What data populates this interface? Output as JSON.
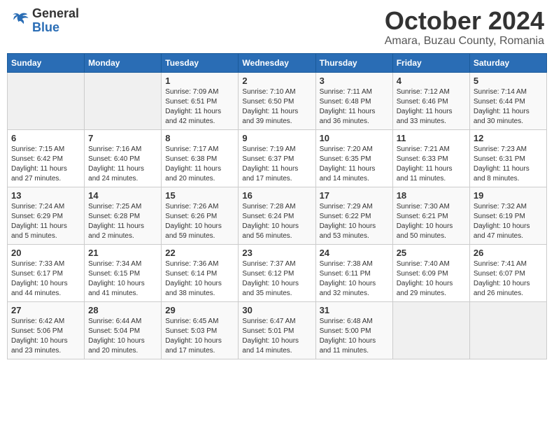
{
  "header": {
    "logo_general": "General",
    "logo_blue": "Blue",
    "month_year": "October 2024",
    "location": "Amara, Buzau County, Romania"
  },
  "days_of_week": [
    "Sunday",
    "Monday",
    "Tuesday",
    "Wednesday",
    "Thursday",
    "Friday",
    "Saturday"
  ],
  "weeks": [
    [
      {
        "num": "",
        "info": ""
      },
      {
        "num": "",
        "info": ""
      },
      {
        "num": "1",
        "info": "Sunrise: 7:09 AM\nSunset: 6:51 PM\nDaylight: 11 hours and 42 minutes."
      },
      {
        "num": "2",
        "info": "Sunrise: 7:10 AM\nSunset: 6:50 PM\nDaylight: 11 hours and 39 minutes."
      },
      {
        "num": "3",
        "info": "Sunrise: 7:11 AM\nSunset: 6:48 PM\nDaylight: 11 hours and 36 minutes."
      },
      {
        "num": "4",
        "info": "Sunrise: 7:12 AM\nSunset: 6:46 PM\nDaylight: 11 hours and 33 minutes."
      },
      {
        "num": "5",
        "info": "Sunrise: 7:14 AM\nSunset: 6:44 PM\nDaylight: 11 hours and 30 minutes."
      }
    ],
    [
      {
        "num": "6",
        "info": "Sunrise: 7:15 AM\nSunset: 6:42 PM\nDaylight: 11 hours and 27 minutes."
      },
      {
        "num": "7",
        "info": "Sunrise: 7:16 AM\nSunset: 6:40 PM\nDaylight: 11 hours and 24 minutes."
      },
      {
        "num": "8",
        "info": "Sunrise: 7:17 AM\nSunset: 6:38 PM\nDaylight: 11 hours and 20 minutes."
      },
      {
        "num": "9",
        "info": "Sunrise: 7:19 AM\nSunset: 6:37 PM\nDaylight: 11 hours and 17 minutes."
      },
      {
        "num": "10",
        "info": "Sunrise: 7:20 AM\nSunset: 6:35 PM\nDaylight: 11 hours and 14 minutes."
      },
      {
        "num": "11",
        "info": "Sunrise: 7:21 AM\nSunset: 6:33 PM\nDaylight: 11 hours and 11 minutes."
      },
      {
        "num": "12",
        "info": "Sunrise: 7:23 AM\nSunset: 6:31 PM\nDaylight: 11 hours and 8 minutes."
      }
    ],
    [
      {
        "num": "13",
        "info": "Sunrise: 7:24 AM\nSunset: 6:29 PM\nDaylight: 11 hours and 5 minutes."
      },
      {
        "num": "14",
        "info": "Sunrise: 7:25 AM\nSunset: 6:28 PM\nDaylight: 11 hours and 2 minutes."
      },
      {
        "num": "15",
        "info": "Sunrise: 7:26 AM\nSunset: 6:26 PM\nDaylight: 10 hours and 59 minutes."
      },
      {
        "num": "16",
        "info": "Sunrise: 7:28 AM\nSunset: 6:24 PM\nDaylight: 10 hours and 56 minutes."
      },
      {
        "num": "17",
        "info": "Sunrise: 7:29 AM\nSunset: 6:22 PM\nDaylight: 10 hours and 53 minutes."
      },
      {
        "num": "18",
        "info": "Sunrise: 7:30 AM\nSunset: 6:21 PM\nDaylight: 10 hours and 50 minutes."
      },
      {
        "num": "19",
        "info": "Sunrise: 7:32 AM\nSunset: 6:19 PM\nDaylight: 10 hours and 47 minutes."
      }
    ],
    [
      {
        "num": "20",
        "info": "Sunrise: 7:33 AM\nSunset: 6:17 PM\nDaylight: 10 hours and 44 minutes."
      },
      {
        "num": "21",
        "info": "Sunrise: 7:34 AM\nSunset: 6:15 PM\nDaylight: 10 hours and 41 minutes."
      },
      {
        "num": "22",
        "info": "Sunrise: 7:36 AM\nSunset: 6:14 PM\nDaylight: 10 hours and 38 minutes."
      },
      {
        "num": "23",
        "info": "Sunrise: 7:37 AM\nSunset: 6:12 PM\nDaylight: 10 hours and 35 minutes."
      },
      {
        "num": "24",
        "info": "Sunrise: 7:38 AM\nSunset: 6:11 PM\nDaylight: 10 hours and 32 minutes."
      },
      {
        "num": "25",
        "info": "Sunrise: 7:40 AM\nSunset: 6:09 PM\nDaylight: 10 hours and 29 minutes."
      },
      {
        "num": "26",
        "info": "Sunrise: 7:41 AM\nSunset: 6:07 PM\nDaylight: 10 hours and 26 minutes."
      }
    ],
    [
      {
        "num": "27",
        "info": "Sunrise: 6:42 AM\nSunset: 5:06 PM\nDaylight: 10 hours and 23 minutes."
      },
      {
        "num": "28",
        "info": "Sunrise: 6:44 AM\nSunset: 5:04 PM\nDaylight: 10 hours and 20 minutes."
      },
      {
        "num": "29",
        "info": "Sunrise: 6:45 AM\nSunset: 5:03 PM\nDaylight: 10 hours and 17 minutes."
      },
      {
        "num": "30",
        "info": "Sunrise: 6:47 AM\nSunset: 5:01 PM\nDaylight: 10 hours and 14 minutes."
      },
      {
        "num": "31",
        "info": "Sunrise: 6:48 AM\nSunset: 5:00 PM\nDaylight: 10 hours and 11 minutes."
      },
      {
        "num": "",
        "info": ""
      },
      {
        "num": "",
        "info": ""
      }
    ]
  ]
}
